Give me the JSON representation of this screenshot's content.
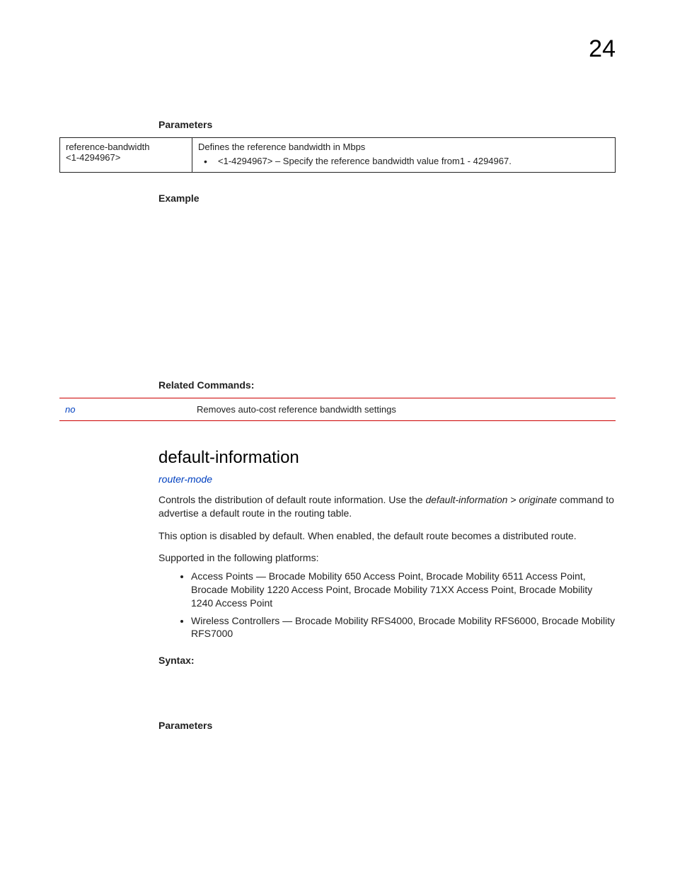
{
  "pageno": "24",
  "param_head": "Parameters",
  "param1": {
    "left_l1": "reference-bandwidth",
    "left_l2": "<1-4294967>",
    "right_l1": "Defines the reference bandwidth in Mbps",
    "right_bullet": "<1-4294967> – Specify the reference bandwidth value from1 - 4294967."
  },
  "example_head": "Example",
  "related_head": "Related Commands:",
  "rel": {
    "left": "no",
    "right": "Removes auto-cost reference bandwidth settings"
  },
  "cmd_title": "default-information",
  "router_mode": "router-mode",
  "para1_a": "Controls the distribution of default route information. Use the ",
  "para1_b": "default-information > originate",
  "para1_c": " command to advertise a default route in the routing table.",
  "para2": "This option is disabled by default. When enabled, the default route becomes a distributed route.",
  "para3": "Supported in the following platforms:",
  "plat1": "Access Points — Brocade Mobility 650 Access Point, Brocade Mobility 6511 Access Point, Brocade Mobility 1220 Access Point, Brocade Mobility 71XX Access Point, Brocade Mobility 1240 Access Point",
  "plat2": "Wireless Controllers — Brocade Mobility RFS4000, Brocade Mobility RFS6000, Brocade Mobility RFS7000",
  "syntax_head": "Syntax:",
  "param_head2": "Parameters"
}
